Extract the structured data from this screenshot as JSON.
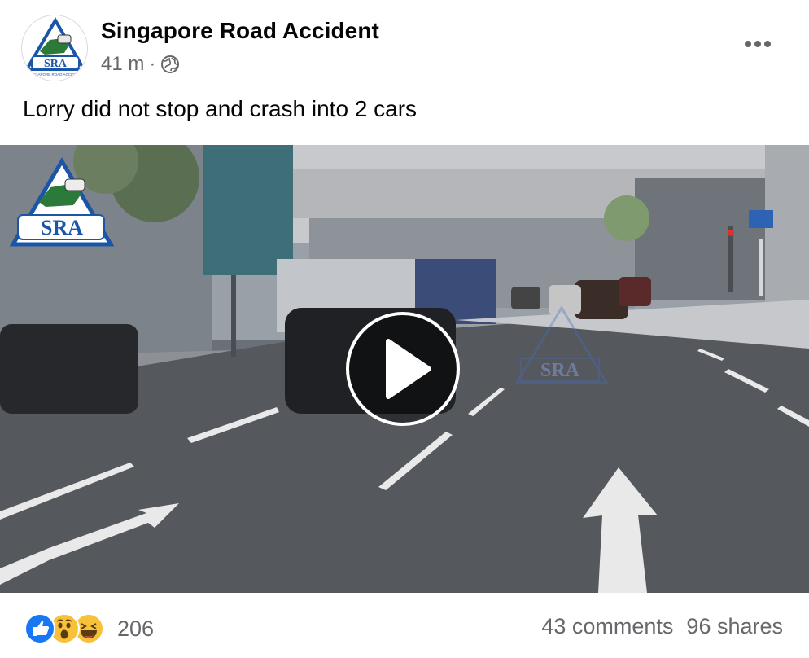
{
  "post": {
    "page_name": "Singapore Road Accident",
    "time": "41 m",
    "separator": "·",
    "privacy_icon": "globe-icon",
    "more_icon": "more-options-icon",
    "text": "Lorry did not stop and crash into 2 cars"
  },
  "avatar": {
    "logo_text": "SRA",
    "logo_subtext": "SINGAPORE ROAD ACCIDENT"
  },
  "video": {
    "watermark_text": "SRA",
    "play_icon": "play-icon"
  },
  "footer": {
    "reaction_icons": [
      "like-icon",
      "wow-icon",
      "haha-icon"
    ],
    "reaction_count": "206",
    "comments": "43 comments",
    "shares": "96 shares"
  },
  "colors": {
    "brand_blue": "#1a55a8",
    "like_blue": "#1877f2",
    "secondary_text": "#65676b"
  }
}
